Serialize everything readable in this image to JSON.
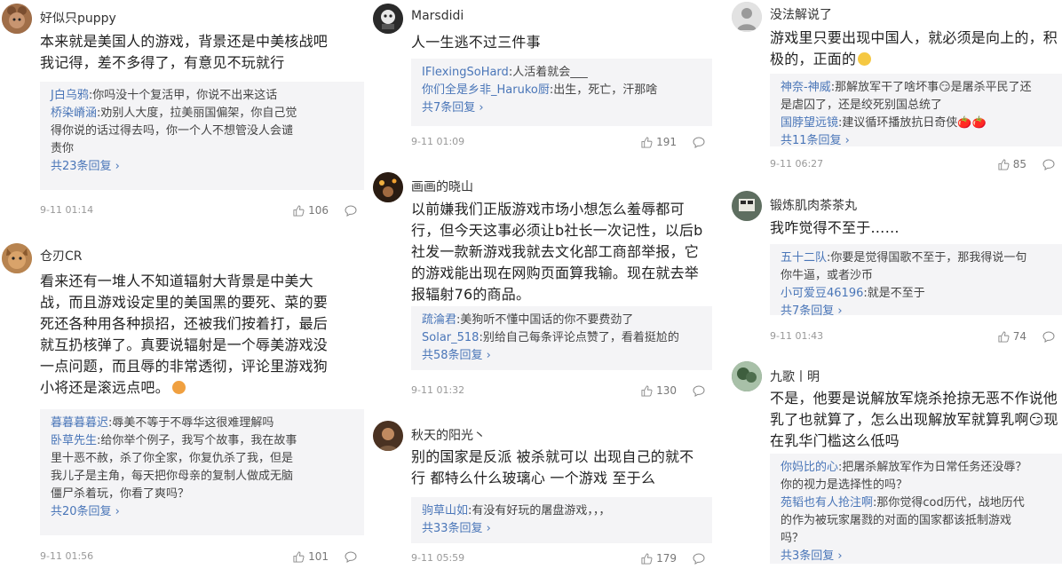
{
  "columns": [
    {
      "comments": [
        {
          "username": "好似只puppy",
          "avatar_color": "#8a5a3c",
          "text": "本来就是美国人的游戏，背景还是中美核战吧\n我记得，差不多得了，有意见不玩就行",
          "replies": [
            {
              "name": "J白乌鸦",
              "text": ":你吗没十个复活甲，你说不出来这话"
            },
            {
              "name": "桥染嵴涵",
              "text": ":劝别人大度，拉美丽国偏架，你自己觉\n得你说的话过得去吗，你一个人不想管没人会谴\n责你"
            }
          ],
          "more": "共23条回复 ›",
          "time": "9-11 01:14",
          "likes": "106"
        },
        {
          "username": "仓刃CR",
          "avatar_color": "#b07a3e",
          "text": "看来还有一堆人不知道辐射大背景是中美大\n战，而且游戏设定里的美国黑的要死、菜的要\n死还各种用各种损招，还被我们按着打，最后\n就互扔核弹了。真要说辐射是一个辱美游戏没\n一点问题，而且辱的非常透彻，评论里游戏狗\n小将还是滚远点吧。",
          "text_emoji": true,
          "replies": [
            {
              "name": "暮暮暮暮迟",
              "text": ":辱美不等于不辱华这很难理解吗"
            },
            {
              "name": "卧草先生",
              "text": ":给你举个例子，我写个故事，我在故事\n里十恶不赦，杀了你全家，你复仇杀了我，但是\n我儿子是主角，每天把你母亲的复制人做成无脑\n僵尸杀着玩，你看了爽吗？"
            }
          ],
          "more": "共20条回复 ›",
          "time": "9-11 01:56",
          "likes": "101"
        }
      ]
    },
    {
      "comments": [
        {
          "username": "Marsdidi",
          "avatar_color": "#2f2f2f",
          "text": "人一生逃不过三件事",
          "replies": [
            {
              "name": "IFlexingSoHard",
              "text": ":人活着就会___"
            },
            {
              "name": "你们全是乡非_Haruko厨",
              "text": ":出生，死亡，汗那啥"
            }
          ],
          "more": "共7条回复 ›",
          "time": "9-11 01:09",
          "likes": "191"
        },
        {
          "username": "画画的晓山",
          "avatar_color": "#3a2a1e",
          "text": "以前嫌我们正版游戏市场小想怎么羞辱都可\n行，但今天这事必须让b社长一次记性，以后b\n社发一款新游戏我就去文化部工商部举报，它\n的游戏能出现在网购页面算我输。现在就去举\n报辐射76的商品。",
          "replies": [
            {
              "name": "疏淪君",
              "text": ":美狗听不懂中国话的你不要费劲了"
            },
            {
              "name": "Solar_518",
              "text": ":别给自己每条评论点赞了，看着挺尬的"
            }
          ],
          "more": "共58条回复 ›",
          "time": "9-11 01:32",
          "likes": "130"
        },
        {
          "username": "秋天的阳光丶",
          "avatar_color": "#6a4a36",
          "text": "别的国家是反派 被杀就可以 出现自己的就不\n行 都特么什么玻璃心 一个游戏 至于么",
          "replies": [
            {
              "name": "驹草山如",
              "text": ":有没有好玩的屠盘游戏，，，"
            }
          ],
          "more": "共33条回复 ›",
          "time": "9-11 05:59",
          "likes": "179"
        }
      ]
    },
    {
      "comments": [
        {
          "username": "没法解说了",
          "avatar_color": "#c9c9c9",
          "text": "游戏里只要出现中国人，就必须是向上的，积\n极的，正面的",
          "text_emoji": true,
          "replies": [
            {
              "name": "神奈-神威",
              "text": ":那解放军干了啥坏事😏是屠杀平民了还\n是虐囚了，还是绞死别国总统了"
            },
            {
              "name": "国脖望远镜",
              "text": ":建议循环播放抗日奇侠🍅🍅"
            }
          ],
          "more": "共11条回复 ›",
          "time": "9-11 06:27",
          "likes": "85"
        },
        {
          "username": "锻炼肌肉茶茶丸",
          "avatar_color": "#7a8a7a",
          "text": "我咋觉得不至于……",
          "replies": [
            {
              "name": "五十二队",
              "text": ":你要是觉得国歌不至于，那我得说一句\n你牛逼，或者沙币"
            },
            {
              "name": "小可爱豆46196",
              "text": ":就是不至于"
            }
          ],
          "more": "共7条回复 ›",
          "time": "9-11 01:43",
          "likes": "74"
        },
        {
          "username": "九歌丨明",
          "avatar_color": "#5b7d5b",
          "text": "不是，他要是说解放军烧杀抢掠无恶不作说他\n乳了也就算了，怎么出现解放军就算乳啊😏现\n在乳华门槛这么低吗",
          "replies": [
            {
              "name": "你妈比的心",
              "text": ":把屠杀解放军作为日常任务还没辱？\n你的视力是选择性的吗？"
            },
            {
              "name": "苑韬也有人抢注啊",
              "text": ":那你觉得cod历代，战地历代\n的作为被玩家屠戮的对面的国家都该抵制游戏\n吗？"
            }
          ],
          "more": "共3条回复 ›",
          "time": "",
          "likes": ""
        }
      ]
    }
  ]
}
